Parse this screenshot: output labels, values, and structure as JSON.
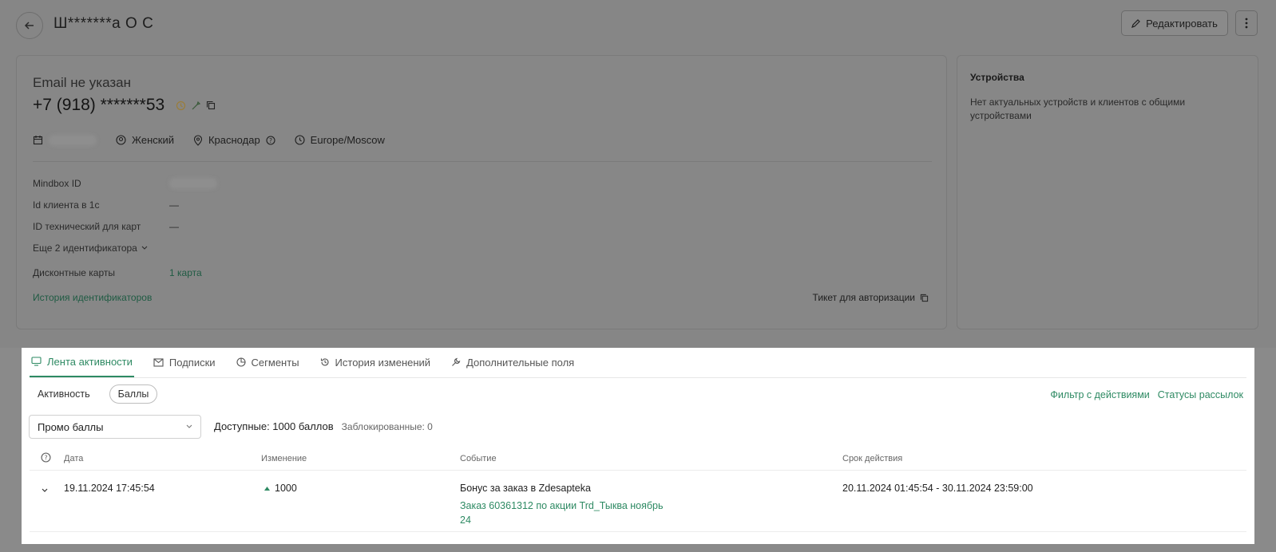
{
  "header": {
    "title": "Ш*******а О С",
    "edit_label": "Редактировать"
  },
  "profile": {
    "email": "Email не указан",
    "phone": "+7 (918) *******53",
    "gender": "Женский",
    "city": "Краснодар",
    "timezone": "Europe/Moscow"
  },
  "identifiers": {
    "rows": [
      {
        "label": "Mindbox ID",
        "value": ""
      },
      {
        "label": "Id клиента в 1с",
        "value": "—"
      },
      {
        "label": "ID технический для карт",
        "value": "—"
      }
    ],
    "more_label": "Еще 2 идентификатора",
    "cards_label": "Дисконтные карты",
    "cards_value": "1 карта",
    "history_link": "История идентификаторов",
    "ticket_label": "Тикет для авторизации"
  },
  "devices": {
    "title": "Устройства",
    "text": "Нет актуальных устройств и клиентов с общими устройствами"
  },
  "tabs": [
    {
      "label": "Лента активности"
    },
    {
      "label": "Подписки"
    },
    {
      "label": "Сегменты"
    },
    {
      "label": "История изменений"
    },
    {
      "label": "Дополнительные поля"
    }
  ],
  "subtabs": [
    "Активность",
    "Баллы"
  ],
  "links": {
    "filter": "Фильтр с действиями",
    "statuses": "Статусы рассылок"
  },
  "balance": {
    "select_value": "Промо баллы",
    "available": "Доступные: 1000 баллов",
    "blocked": "Заблокированные: 0"
  },
  "table": {
    "headers": [
      "Дата",
      "Изменение",
      "Событие",
      "Срок действия"
    ],
    "rows": [
      {
        "date": "19.11.2024 17:45:54",
        "change": "1000",
        "event": "Бонус за заказ в Zdesapteka",
        "event_link": "Заказ 60361312 по акции Trd_Тыква ноябрь 24",
        "validity": "20.11.2024 01:45:54 - 30.11.2024 23:59:00"
      }
    ]
  },
  "colors": {
    "accent": "#2e8a63",
    "overlay": "#868686"
  }
}
